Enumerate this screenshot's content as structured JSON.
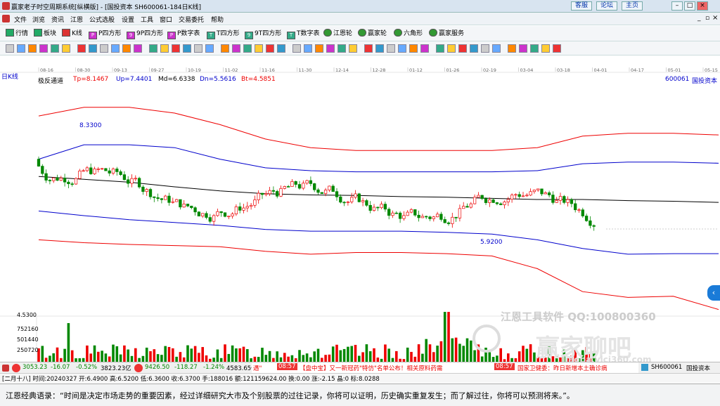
{
  "window": {
    "title": "赢家老子时空周期系统[纵横版] - [国投资本  SH600061-184日K线]",
    "buttons": [
      "客服",
      "论坛",
      "主页"
    ]
  },
  "menu": [
    "文件",
    "浏览",
    "资讯",
    "江恩",
    "公式选股",
    "设置",
    "工具",
    "窗口",
    "交易委托",
    "帮助"
  ],
  "toolbar": [
    {
      "label": "行情",
      "icon": "grid-icon"
    },
    {
      "label": "板块",
      "icon": "blocks-icon"
    },
    {
      "label": "K线",
      "icon": "candles-icon"
    },
    {
      "label": "P四方形",
      "icon": "p-square-icon"
    },
    {
      "label": "9P四方形",
      "icon": "9p-square-icon"
    },
    {
      "label": "P数字表",
      "icon": "p-table-icon"
    },
    {
      "label": "T四方形",
      "icon": "t-square-icon"
    },
    {
      "label": "9T四方形",
      "icon": "9t-square-icon"
    },
    {
      "label": "T数字表",
      "icon": "t-table-icon"
    },
    {
      "label": "江恩轮",
      "icon": "gann-wheel-icon"
    },
    {
      "label": "赢家轮",
      "icon": "winner-wheel-icon"
    },
    {
      "label": "六角形",
      "icon": "hexagon-icon"
    },
    {
      "label": "赢家服务",
      "icon": "service-icon"
    }
  ],
  "chart": {
    "period_label": "日K线",
    "date_ticks": [
      "08-16",
      "08-30",
      "09-13",
      "09-27",
      "10-19",
      "11-02",
      "11-16",
      "11-30",
      "12-14",
      "12-28",
      "01-12",
      "01-26",
      "02-19",
      "03-04",
      "03-18",
      "04-01",
      "04-17",
      "05-01",
      "05-15"
    ],
    "indicator": {
      "name": "极反通道",
      "tp": "Tp=8.1467",
      "up": "Up=7.4401",
      "md": "Md=6.6338",
      "dn": "Dn=5.5616",
      "bt": "Bt=4.5851"
    },
    "code": "600061",
    "stock_name": "国投资本",
    "annotation_high": "8.3300",
    "annotation_low": "5.9200",
    "volume_ticks": [
      "4.5300",
      "752160",
      "501440",
      "250720"
    ],
    "watermark_line": "江恩工具软件  QQ:100800360",
    "watermark_brand": "赢家聊吧",
    "watermark_url": "liaoba.vici360.com"
  },
  "chart_data": {
    "type": "line",
    "title": "极反通道",
    "x": [
      "08-16",
      "08-30",
      "09-13",
      "09-27",
      "10-19",
      "11-02",
      "11-16",
      "11-30",
      "12-14",
      "12-28",
      "01-12",
      "01-26",
      "02-19",
      "03-04",
      "03-18",
      "04-01"
    ],
    "series": [
      {
        "name": "Tp",
        "values": [
          7.95,
          8.1,
          8.1,
          8.0,
          7.8,
          7.55,
          7.4,
          7.35,
          7.35,
          7.35,
          7.35,
          7.4,
          7.6,
          7.65,
          7.65,
          7.62
        ]
      },
      {
        "name": "Up",
        "values": [
          7.2,
          7.45,
          7.45,
          7.4,
          7.2,
          7.05,
          7.0,
          6.98,
          6.98,
          6.98,
          6.98,
          7.0,
          7.12,
          7.15,
          7.15,
          7.13
        ]
      },
      {
        "name": "Md",
        "values": [
          6.9,
          6.85,
          6.8,
          6.72,
          6.65,
          6.6,
          6.58,
          6.57,
          6.55,
          6.54,
          6.52,
          6.5,
          6.5,
          6.48,
          6.47,
          6.45
        ]
      },
      {
        "name": "Dn",
        "values": [
          6.3,
          6.22,
          6.15,
          6.1,
          6.05,
          5.98,
          5.95,
          5.95,
          5.95,
          5.93,
          5.9,
          5.8,
          5.65,
          5.55,
          5.56,
          5.56
        ]
      },
      {
        "name": "Bt",
        "values": [
          5.8,
          5.75,
          5.72,
          5.7,
          5.68,
          5.6,
          5.55,
          5.58,
          5.58,
          5.56,
          5.52,
          5.3,
          4.9,
          4.8,
          4.82,
          4.59
        ]
      }
    ],
    "ylim": [
      4.5,
      8.5
    ]
  },
  "status": {
    "idx1_val": "3053.23",
    "idx1_chg": "-16.07",
    "idx1_pct": "-0.52%",
    "idx1_amt": "3823.23亿",
    "idx2_val": "9426.50",
    "idx2_chg": "-118.27",
    "idx2_pct": "-1.24%",
    "idx2_amt": "4583.65亿",
    "ticker1": "遇\"",
    "time1": "08:57",
    "news1": "【盘中宝】又一新冠药\"特仿\"名单公布！相关原料药需",
    "time2": "08:57",
    "news2": "国家卫健委：昨日新增本土确诊病",
    "stock_code": "SH600061",
    "stock_name": "国投资本"
  },
  "dateinfo": "[二月十八] 时间:20240327 开:6.4900 高:6.5200 低:6.3600 收:6.3700 手:188016 额:121159624.00 换:0.00 涨:-2.15 晶:0 标:8.0288",
  "quote": "江恩经典语录：“时间是决定市场走势的重要因素，经过详细研究大市及个别股票的过往记录，你将可以证明，历史确实重复发生；而了解过往，你将可以预测将来。”。"
}
